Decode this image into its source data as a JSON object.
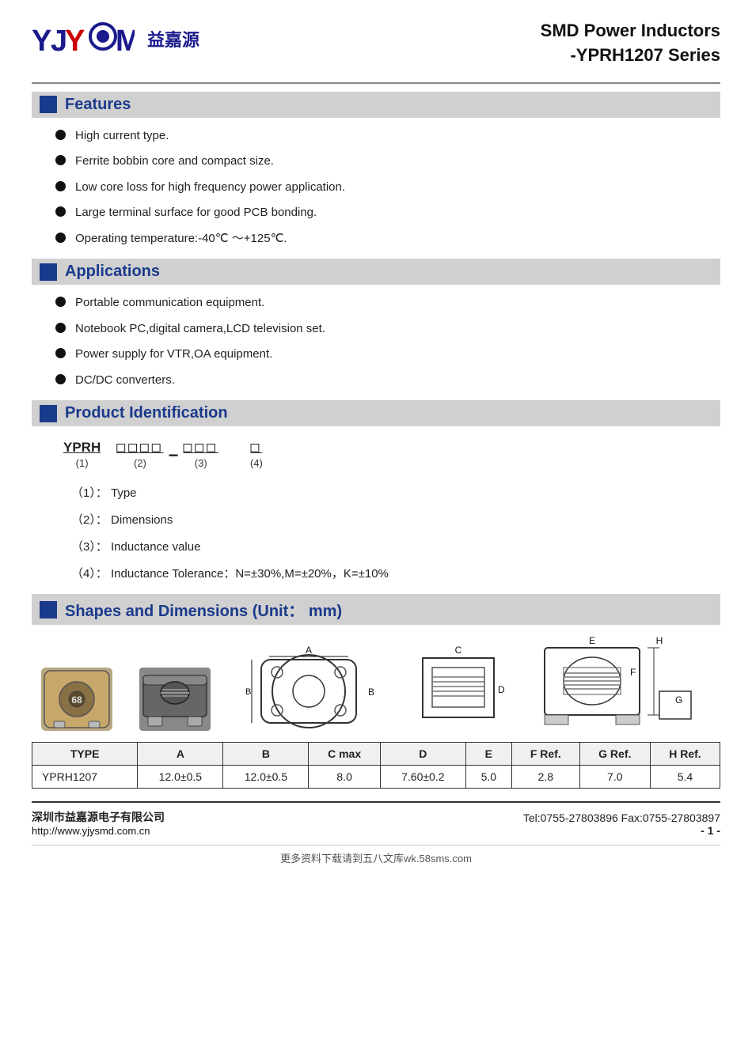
{
  "header": {
    "logo_text": "YJYCOM",
    "logo_chinese": "益嘉源",
    "title_line1": "SMD Power Inductors",
    "title_line2": "-YPRH1207 Series"
  },
  "features": {
    "section_title": "Features",
    "items": [
      "High current type.",
      "Ferrite bobbin core and compact size.",
      "Low core loss for high frequency power application.",
      "Large terminal surface for good PCB bonding.",
      "Operating temperature:-40℃ ～+125℃."
    ]
  },
  "applications": {
    "section_title": "Applications",
    "items": [
      "Portable communication equipment.",
      "Notebook PC,digital camera,LCD television set.",
      "Power supply for VTR,OA equipment.",
      "DC/DC converters."
    ]
  },
  "product_identification": {
    "section_title": "Product Identification",
    "prefix": "YPRH",
    "field1_boxes": "□□□□",
    "dash": "−",
    "field2_boxes": "□□□",
    "field3_box": "□",
    "num1": "(1)",
    "num2": "(2)",
    "num3": "(3)",
    "num4": "(4)",
    "desc1": "（1）： Type",
    "desc2": "（2）： Dimensions",
    "desc3": "（3）： Inductance value",
    "desc4": "（4）： Inductance Tolerance：N=±30%,M=±20%，K=±10%"
  },
  "shapes": {
    "section_title": "Shapes and Dimensions (Unit： mm)",
    "labels": {
      "A": "A",
      "B": "B",
      "C": "C",
      "D": "D",
      "E": "E",
      "F": "F",
      "G": "G",
      "H": "H"
    }
  },
  "table": {
    "headers": [
      "TYPE",
      "A",
      "B",
      "C max",
      "D",
      "E",
      "F Ref.",
      "G Ref.",
      "H Ref."
    ],
    "rows": [
      [
        "YPRH1207",
        "12.0±0.5",
        "12.0±0.5",
        "8.0",
        "7.60±0.2",
        "5.0",
        "2.8",
        "7.0",
        "5.4"
      ]
    ]
  },
  "footer": {
    "company_name": "深圳市益嘉源电子有限公司",
    "url": "http://www.yjysmd.com.cn",
    "contact": "Tel:0755-27803896    Fax:0755-27803897",
    "page": "- 1 -"
  },
  "bottom_note": "更多资料下载请到五八文库wk.58sms.com"
}
